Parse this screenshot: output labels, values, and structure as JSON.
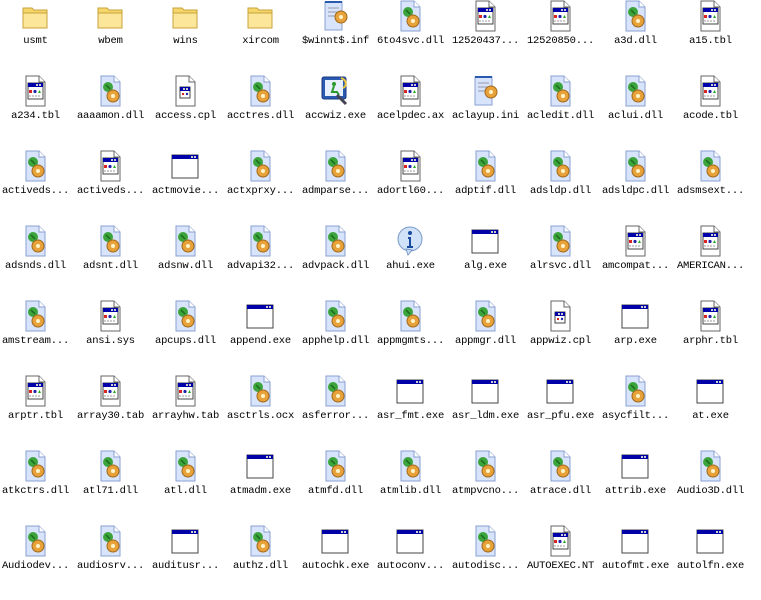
{
  "colors": {
    "titlebar": "#0000a8",
    "folder": "#f5d66b",
    "dll_page": "#d8e4fb"
  },
  "items": [
    {
      "label": "usmt",
      "type": "folder"
    },
    {
      "label": "wbem",
      "type": "folder"
    },
    {
      "label": "wins",
      "type": "folder"
    },
    {
      "label": "xircom",
      "type": "folder"
    },
    {
      "label": "$winnt$.inf",
      "type": "ini"
    },
    {
      "label": "6to4svc.dll",
      "type": "dll"
    },
    {
      "label": "12520437...",
      "type": "doc"
    },
    {
      "label": "12520850...",
      "type": "doc"
    },
    {
      "label": "a3d.dll",
      "type": "dll"
    },
    {
      "label": "a15.tbl",
      "type": "doc"
    },
    {
      "label": "a234.tbl",
      "type": "doc"
    },
    {
      "label": "aaaamon.dll",
      "type": "dll"
    },
    {
      "label": "access.cpl",
      "type": "cpl"
    },
    {
      "label": "acctres.dll",
      "type": "dll"
    },
    {
      "label": "accwiz.exe",
      "type": "wizard"
    },
    {
      "label": "acelpdec.ax",
      "type": "doc"
    },
    {
      "label": "aclayup.ini",
      "type": "ini"
    },
    {
      "label": "acledit.dll",
      "type": "dll"
    },
    {
      "label": "aclui.dll",
      "type": "dll"
    },
    {
      "label": "acode.tbl",
      "type": "doc"
    },
    {
      "label": "activeds...",
      "type": "dll"
    },
    {
      "label": "activeds...",
      "type": "doc"
    },
    {
      "label": "actmovie...",
      "type": "exe"
    },
    {
      "label": "actxprxy...",
      "type": "dll"
    },
    {
      "label": "admparse...",
      "type": "dll"
    },
    {
      "label": "adortl60...",
      "type": "doc"
    },
    {
      "label": "adptif.dll",
      "type": "dll"
    },
    {
      "label": "adsldp.dll",
      "type": "dll"
    },
    {
      "label": "adsldpc.dll",
      "type": "dll"
    },
    {
      "label": "adsmsext...",
      "type": "dll"
    },
    {
      "label": "adsnds.dll",
      "type": "dll"
    },
    {
      "label": "adsnt.dll",
      "type": "dll"
    },
    {
      "label": "adsnw.dll",
      "type": "dll"
    },
    {
      "label": "advapi32...",
      "type": "dll"
    },
    {
      "label": "advpack.dll",
      "type": "dll"
    },
    {
      "label": "ahui.exe",
      "type": "info"
    },
    {
      "label": "alg.exe",
      "type": "exe"
    },
    {
      "label": "alrsvc.dll",
      "type": "dll"
    },
    {
      "label": "amcompat...",
      "type": "doc"
    },
    {
      "label": "AMERICAN...",
      "type": "doc"
    },
    {
      "label": "amstream...",
      "type": "dll"
    },
    {
      "label": "ansi.sys",
      "type": "doc"
    },
    {
      "label": "apcups.dll",
      "type": "dll"
    },
    {
      "label": "append.exe",
      "type": "exe"
    },
    {
      "label": "apphelp.dll",
      "type": "dll"
    },
    {
      "label": "appmgmts...",
      "type": "dll"
    },
    {
      "label": "appmgr.dll",
      "type": "dll"
    },
    {
      "label": "appwiz.cpl",
      "type": "cpl"
    },
    {
      "label": "arp.exe",
      "type": "exe"
    },
    {
      "label": "arphr.tbl",
      "type": "doc"
    },
    {
      "label": "arptr.tbl",
      "type": "doc"
    },
    {
      "label": "array30.tab",
      "type": "doc"
    },
    {
      "label": "arrayhw.tab",
      "type": "doc"
    },
    {
      "label": "asctrls.ocx",
      "type": "dll"
    },
    {
      "label": "asferror...",
      "type": "dll"
    },
    {
      "label": "asr_fmt.exe",
      "type": "exe"
    },
    {
      "label": "asr_ldm.exe",
      "type": "exe"
    },
    {
      "label": "asr_pfu.exe",
      "type": "exe"
    },
    {
      "label": "asycfilt...",
      "type": "dll"
    },
    {
      "label": "at.exe",
      "type": "exe"
    },
    {
      "label": "atkctrs.dll",
      "type": "dll"
    },
    {
      "label": "atl71.dll",
      "type": "dll"
    },
    {
      "label": "atl.dll",
      "type": "dll"
    },
    {
      "label": "atmadm.exe",
      "type": "exe"
    },
    {
      "label": "atmfd.dll",
      "type": "dll"
    },
    {
      "label": "atmlib.dll",
      "type": "dll"
    },
    {
      "label": "atmpvcno...",
      "type": "dll"
    },
    {
      "label": "atrace.dll",
      "type": "dll"
    },
    {
      "label": "attrib.exe",
      "type": "exe"
    },
    {
      "label": "Audio3D.dll",
      "type": "dll"
    },
    {
      "label": "Audiodev...",
      "type": "dll"
    },
    {
      "label": "audiosrv...",
      "type": "dll"
    },
    {
      "label": "auditusr...",
      "type": "exe"
    },
    {
      "label": "authz.dll",
      "type": "dll"
    },
    {
      "label": "autochk.exe",
      "type": "exe"
    },
    {
      "label": "autoconv...",
      "type": "exe"
    },
    {
      "label": "autodisc...",
      "type": "dll"
    },
    {
      "label": "AUTOEXEC.NT",
      "type": "doc"
    },
    {
      "label": "autofmt.exe",
      "type": "exe"
    },
    {
      "label": "autolfn.exe",
      "type": "exe"
    }
  ]
}
